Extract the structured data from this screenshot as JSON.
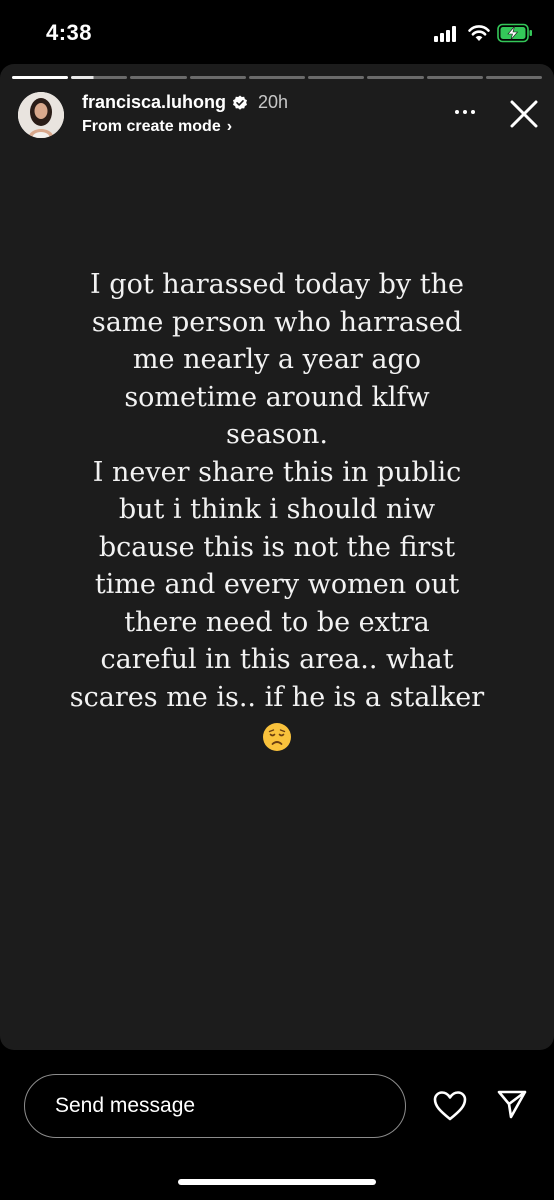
{
  "status_bar": {
    "time": "4:38",
    "icons": [
      "signal-icon",
      "wifi-icon",
      "battery-charging-icon"
    ],
    "battery_color": "#34c759"
  },
  "story": {
    "segments_total": 9,
    "segments_completed": 1,
    "current_segment_progress": 0.4,
    "author": {
      "username": "francisca.luhong",
      "verified": true,
      "time_ago": "20h",
      "subtitle": "From create mode",
      "subtitle_icon": "chevron-right-icon"
    },
    "text_lines": [
      "I got harassed today by the",
      "same person who harrased",
      "me nearly a year ago",
      "sometime around klfw",
      "season.",
      "I never share this in public",
      "but i think i should niw",
      "bcause this is not the first",
      "time and every women out",
      "there need to be extra",
      "careful in this area.. what",
      "scares me is.. if he is a stalker"
    ],
    "emoji": "disappointed-face-emoji",
    "background_color": "#1c1c1c"
  },
  "footer": {
    "message_placeholder": "Send message",
    "icons": [
      "heart-icon",
      "send-icon",
      "more-icon",
      "close-icon"
    ]
  }
}
